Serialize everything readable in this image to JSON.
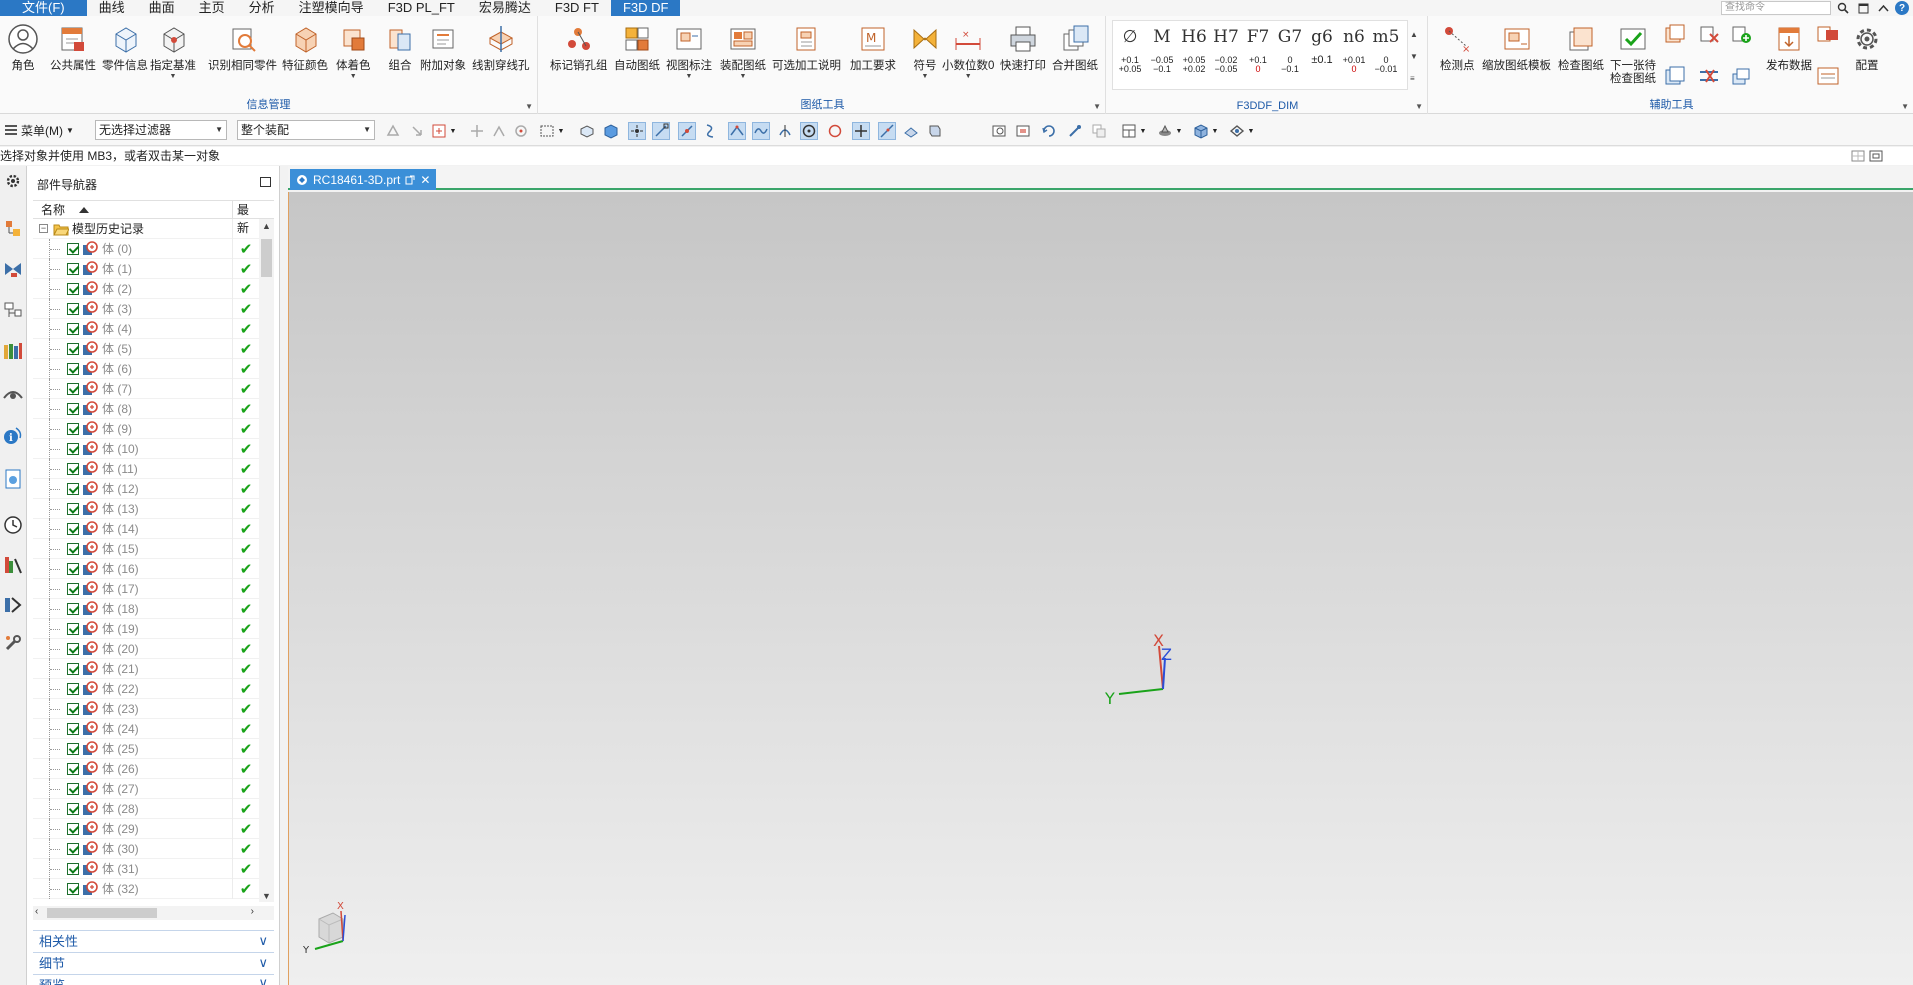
{
  "menubar": {
    "items": [
      "文件(F)",
      "曲线",
      "曲面",
      "主页",
      "分析",
      "注塑模向导",
      "F3D PL_FT",
      "宏易腾达",
      "F3D FT",
      "F3D DF"
    ],
    "search_placeholder": "查找命令"
  },
  "ribbon": {
    "groups": {
      "info": "信息管理",
      "drawing": "图纸工具",
      "dim": "F3DDF_DIM",
      "aux": "辅助工具"
    },
    "info_tools": [
      "角色",
      "公共属性",
      "零件信息",
      "指定基准",
      "识别相同零件",
      "特征颜色",
      "体着色",
      "组合",
      "附加对象",
      "线割穿线孔"
    ],
    "drawing_tools": [
      "标记销孔组",
      "自动图纸",
      "视图标注",
      "装配图纸",
      "可选加工说明",
      "加工要求",
      "符号",
      "小数位数0",
      "快速打印",
      "合并图纸"
    ],
    "dim_symbols": [
      "∅",
      "M",
      "H6",
      "H7",
      "F7",
      "G7",
      "g6",
      "n6",
      "m5"
    ],
    "dim_tolerances": [
      [
        "+0.1",
        "+0.05"
      ],
      [
        "−0.05",
        "−0.1"
      ],
      [
        "+0.05",
        "+0.02"
      ],
      [
        "−0.02",
        "−0.05"
      ],
      [
        "+0.1",
        "0"
      ],
      [
        "0",
        "−0.1"
      ],
      [
        "±0.1",
        ""
      ],
      [
        "+0.01",
        "0"
      ],
      [
        "0",
        "−0.01"
      ]
    ],
    "aux_tools": [
      "检测点",
      "缩放图纸模板",
      "检查图纸",
      "下一张待\n检查图纸",
      "发布数据",
      "配置"
    ]
  },
  "toolbar": {
    "menu_label": "菜单(M)",
    "filter_value": "无选择过滤器",
    "scope_value": "整个装配"
  },
  "status": {
    "prompt": "选择对象并使用 MB3，或者双击某一对象"
  },
  "navigator": {
    "title": "部件导航器",
    "col_name": "名称",
    "col_latest": "最新",
    "root": "模型历史记录",
    "body_prefix": "体",
    "bodies": [
      "体 (0)",
      "体 (1)",
      "体 (2)",
      "体 (3)",
      "体 (4)",
      "体 (5)",
      "体 (6)",
      "体 (7)",
      "体 (8)",
      "体 (9)",
      "体 (10)",
      "体 (11)",
      "体 (12)",
      "体 (13)",
      "体 (14)",
      "体 (15)",
      "体 (16)",
      "体 (17)",
      "体 (18)",
      "体 (19)",
      "体 (20)",
      "体 (21)",
      "体 (22)",
      "体 (23)",
      "体 (24)",
      "体 (25)",
      "体 (26)",
      "体 (27)",
      "体 (28)",
      "体 (29)",
      "体 (30)",
      "体 (31)",
      "体 (32)"
    ],
    "panels": [
      "相关性",
      "细节",
      "预览"
    ]
  },
  "graphics": {
    "tab_title": "RC18461-3D.prt",
    "axis_x": "X",
    "axis_y": "Y",
    "axis_z": "Z"
  },
  "colors": {
    "accent": "#2b78c5",
    "tab": "#3b8fd8",
    "check": "#1aa31a",
    "group_label": "#1e5aa8"
  }
}
